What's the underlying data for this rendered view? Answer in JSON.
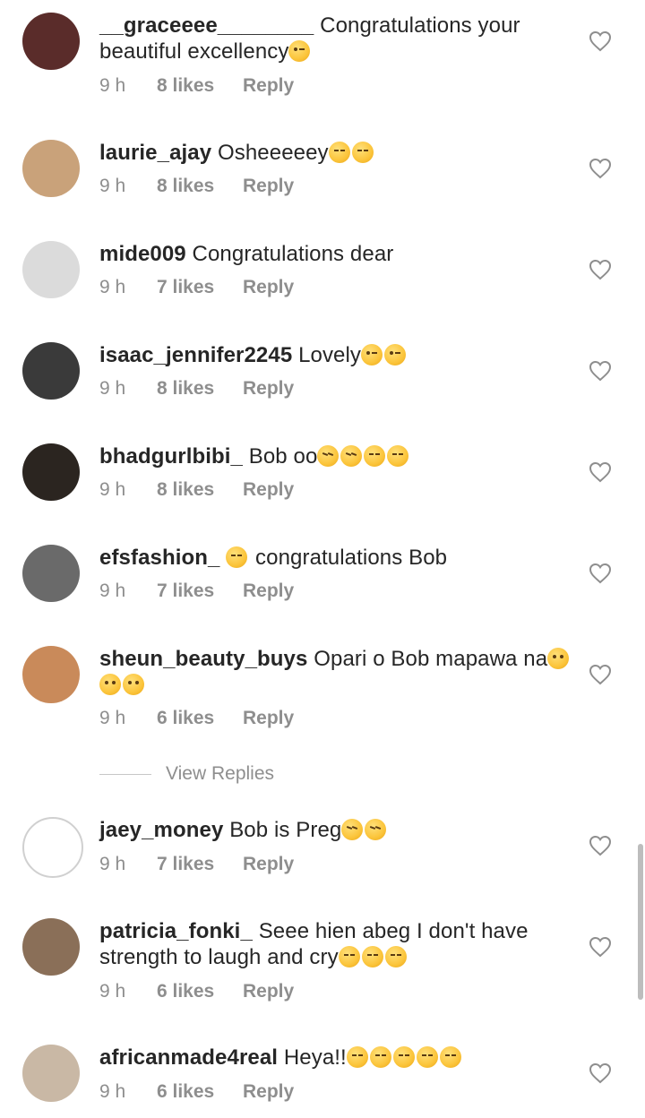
{
  "comments": [
    {
      "user": "__graceeee________",
      "text": "Congratulations your beautiful excellency",
      "emojis": [
        "kiss"
      ],
      "time": "9 h",
      "likes": "8 likes",
      "reply": "Reply",
      "avatar_color": "#5a2c2a"
    },
    {
      "user": "laurie_ajay",
      "text": "Osheeeeey",
      "emojis": [
        "laugh",
        "laugh"
      ],
      "time": "9 h",
      "likes": "8 likes",
      "reply": "Reply",
      "avatar_color": "#c9a27a"
    },
    {
      "user": "mide009",
      "text": "Congratulations dear",
      "emojis": [],
      "time": "9 h",
      "likes": "7 likes",
      "reply": "Reply",
      "avatar_color": "#dbdbdb"
    },
    {
      "user": "isaac_jennifer2245",
      "text": "Lovely",
      "emojis": [
        "kiss",
        "kiss"
      ],
      "time": "9 h",
      "likes": "8 likes",
      "reply": "Reply",
      "avatar_color": "#3a3a3a"
    },
    {
      "user": "bhadgurlbibi_",
      "text": "Bob oo",
      "emojis": [
        "tired",
        "tired",
        "laugh",
        "laugh"
      ],
      "time": "9 h",
      "likes": "8 likes",
      "reply": "Reply",
      "avatar_color": "#2b2520"
    },
    {
      "user": "efsfashion_",
      "text": "congratulations Bob",
      "emojis_before": [
        "laugh"
      ],
      "emojis": [],
      "time": "9 h",
      "likes": "7 likes",
      "reply": "Reply",
      "avatar_color": "#6a6a6a"
    },
    {
      "user": "sheun_beauty_buys",
      "text": "Opari o Bob mapawa na",
      "emojis": [
        "smile",
        "smile",
        "smile"
      ],
      "time": "9 h",
      "likes": "6 likes",
      "reply": "Reply",
      "avatar_color": "#c98a5a"
    },
    {
      "user": "jaey_money",
      "text": "Bob is Preg",
      "emojis": [
        "tired",
        "tired"
      ],
      "time": "9 h",
      "likes": "7 likes",
      "reply": "Reply",
      "avatar_color": "#ffffff"
    },
    {
      "user": "patricia_fonki_",
      "text": "Seee hien abeg I don't have strength to laugh and cry",
      "emojis": [
        "laugh",
        "laugh",
        "laugh"
      ],
      "time": "9 h",
      "likes": "6 likes",
      "reply": "Reply",
      "avatar_color": "#8a6f58"
    },
    {
      "user": "africanmade4real",
      "text": "Heya!!",
      "emojis": [
        "laugh",
        "laugh",
        "laugh",
        "laugh",
        "laugh"
      ],
      "time": "9 h",
      "likes": "6 likes",
      "reply": "Reply",
      "avatar_color": "#c9b8a5"
    }
  ],
  "view_replies_label": "View Replies",
  "heart_icon": "heart-outline-icon",
  "colors": {
    "text": "#262626",
    "meta": "#8e8e8e",
    "divider": "#c7c7c7"
  }
}
